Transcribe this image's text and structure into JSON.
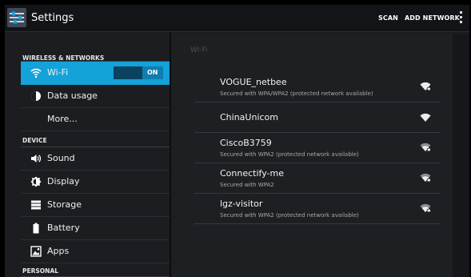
{
  "app": {
    "title": "Settings"
  },
  "actions": {
    "scan": "SCAN",
    "add_network": "ADD NETWORK"
  },
  "sidebar": {
    "headers": {
      "wireless": "WIRELESS & NETWORKS",
      "device": "DEVICE",
      "personal": "PERSONAL"
    },
    "items": [
      {
        "label": "Wi-Fi",
        "icon": "wifi-icon",
        "selected": true
      },
      {
        "label": "Data usage",
        "icon": "data-usage-icon"
      },
      {
        "label": "More..."
      },
      {
        "label": "Sound",
        "icon": "speaker-icon"
      },
      {
        "label": "Display",
        "icon": "brightness-icon"
      },
      {
        "label": "Storage",
        "icon": "storage-icon"
      },
      {
        "label": "Battery",
        "icon": "battery-icon"
      },
      {
        "label": "Apps",
        "icon": "apps-icon"
      }
    ],
    "wifi_toggle": "ON"
  },
  "wifi": {
    "title": "Wi-Fi",
    "networks": [
      {
        "ssid": "VOGUE_netbee",
        "security": "Secured with WPA/WPA2 (protected network available)",
        "signal_icon": "wifi-signal-lock-icon"
      },
      {
        "ssid": "ChinaUnicom",
        "security": "",
        "signal_icon": "wifi-signal-icon"
      },
      {
        "ssid": "CiscoB3759",
        "security": "Secured with WPA2 (protected network available)",
        "signal_icon": "wifi-signal-lock-icon"
      },
      {
        "ssid": "Connectify-me",
        "security": "Secured with WPA2",
        "signal_icon": "wifi-signal-lock-icon"
      },
      {
        "ssid": "lgz-visitor",
        "security": "Secured with WPA2 (protected network available)",
        "signal_icon": "wifi-signal-lock-icon"
      }
    ]
  },
  "colors": {
    "accent": "#14a2d8",
    "background": "#1a1c20"
  }
}
